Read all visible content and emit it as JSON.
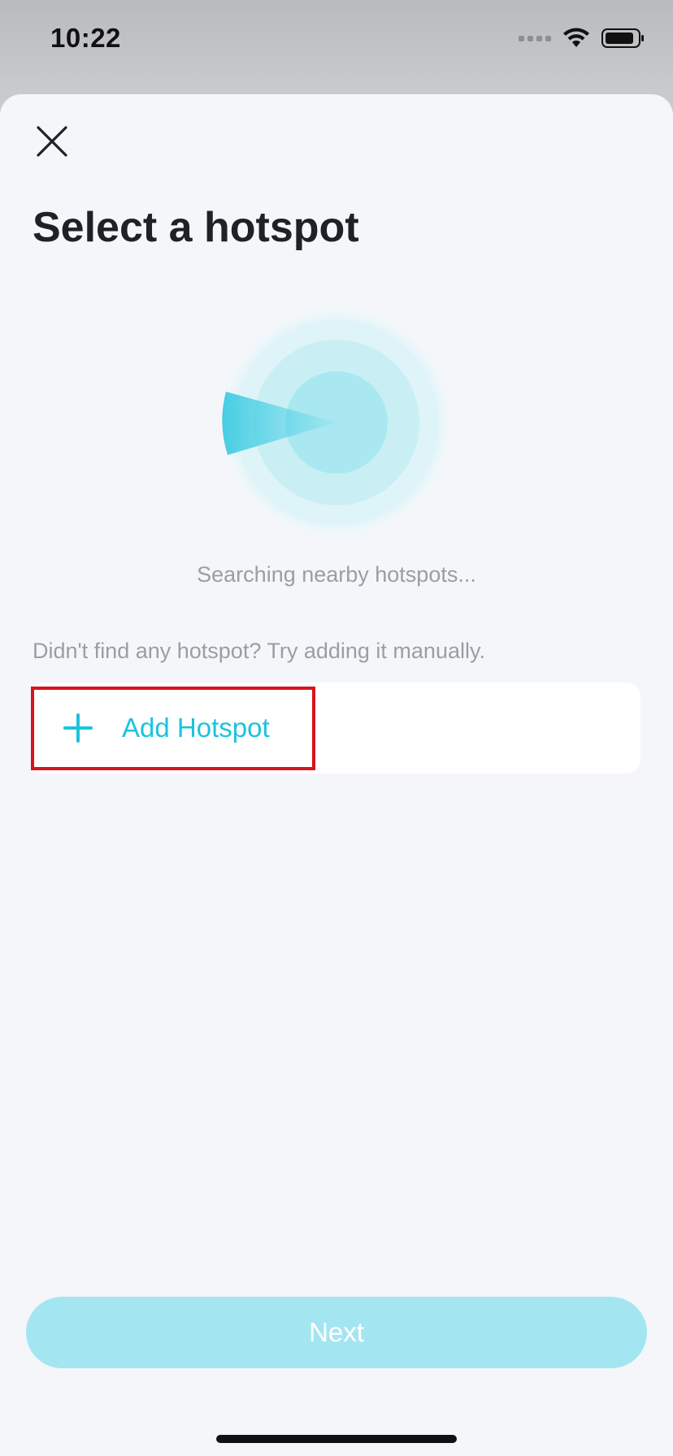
{
  "status_bar": {
    "time": "10:22"
  },
  "header": {
    "title": "Select a hotspot",
    "close_icon": "close-icon"
  },
  "radar": {
    "status_text": "Searching nearby hotspots...",
    "accent_color": "#1cc3dd"
  },
  "manual": {
    "hint": "Didn't find any hotspot? Try adding it manually.",
    "add_label": "Add Hotspot",
    "add_icon": "plus-icon"
  },
  "footer": {
    "next_label": "Next"
  },
  "colors": {
    "accent": "#1cc3dd",
    "next_disabled": "#a3e6f1",
    "highlight": "#d9141b",
    "background": "#f5f6fa"
  }
}
